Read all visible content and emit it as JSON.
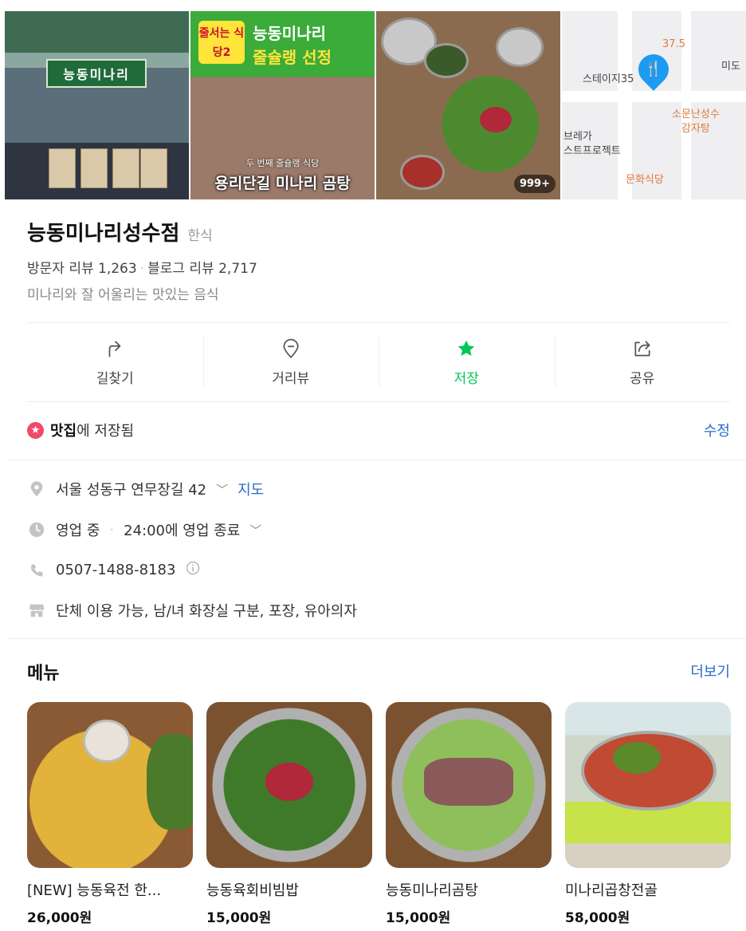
{
  "gallery": {
    "photo1_sign": "능동미나리",
    "photo2_badge": "줄서는 식당2",
    "photo2_line1": "능동미나리",
    "photo2_line2": "줄슐랭 선정",
    "photo2_sub": "두 번째 줄슐랭 식당",
    "photo2_caption": "용리단길 미나리 곰탕",
    "photo3_count": "999+",
    "map_labels": [
      "37.5",
      "스테이지35",
      "미도",
      "소문난성수",
      "감자탕",
      "브레가",
      "스트프로젝트",
      "문화식당"
    ]
  },
  "place": {
    "name": "능동미나리성수점",
    "category": "한식",
    "visitor_reviews_label": "방문자 리뷰",
    "visitor_reviews_count": "1,263",
    "blog_reviews_label": "블로그 리뷰",
    "blog_reviews_count": "2,717",
    "description": "미나리와 잘 어울리는 맛있는 음식"
  },
  "actions": [
    {
      "label": "길찾기",
      "icon": "directions-icon"
    },
    {
      "label": "거리뷰",
      "icon": "location-pin-icon"
    },
    {
      "label": "저장",
      "icon": "star-icon"
    },
    {
      "label": "공유",
      "icon": "share-icon"
    }
  ],
  "saved": {
    "list_name": "맛집",
    "suffix": "에 저장됨",
    "edit_label": "수정"
  },
  "info": {
    "address": "서울 성동구 연무장길 42",
    "map_link": "지도",
    "status": "영업 중",
    "hours": "24:00에 영업 종료",
    "phone": "0507-1488-8183",
    "amenities": "단체 이용 가능, 남/녀 화장실 구분, 포장, 유아의자"
  },
  "menu": {
    "heading": "메뉴",
    "more_label": "더보기",
    "items": [
      {
        "name": "[NEW] 능동육전 한...",
        "price": "26,000원"
      },
      {
        "name": "능동육회비빔밥",
        "price": "15,000원"
      },
      {
        "name": "능동미나리곰탕",
        "price": "15,000원"
      },
      {
        "name": "미나리곱창전골",
        "price": "58,000원"
      }
    ]
  },
  "colors": {
    "accent_green": "#03c75a",
    "link_blue": "#2c6bc8",
    "map_pin_blue": "#1e9bf0",
    "saved_star_pink": "#f04a6a"
  }
}
